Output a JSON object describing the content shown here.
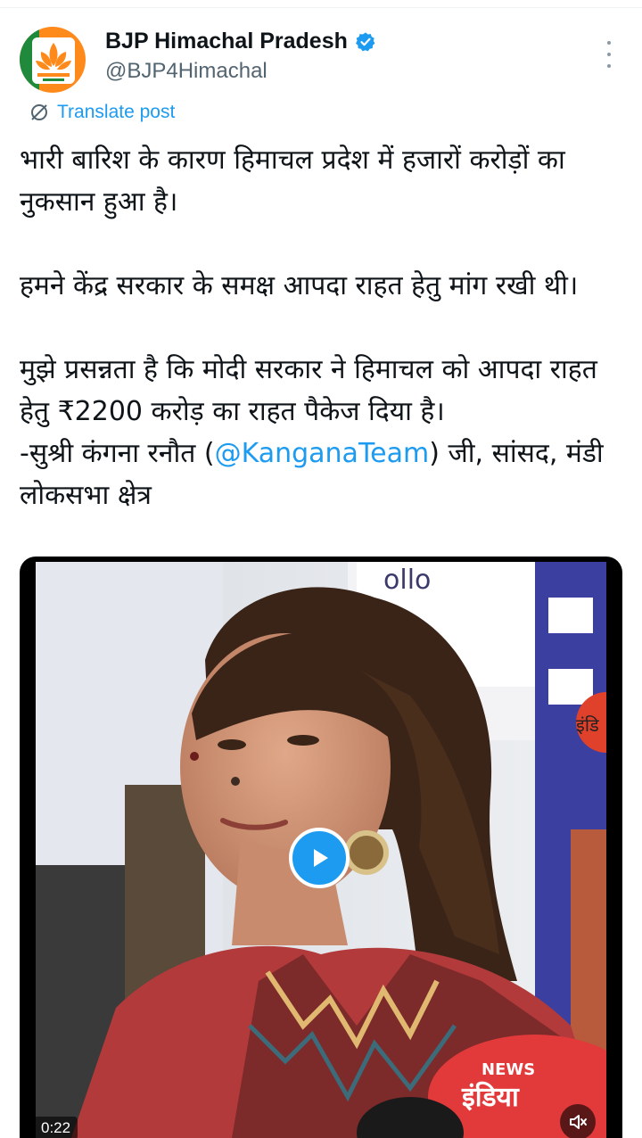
{
  "account": {
    "display_name": "BJP Himachal Pradesh",
    "handle": "@BJP4Himachal",
    "verified": true,
    "avatar_icon": "lotus-logo-icon"
  },
  "translate": {
    "label": "Translate post",
    "icon": "globe-icon"
  },
  "post": {
    "paragraph_1": "भारी बारिश के कारण हिमाचल प्रदेश में हजारों करोड़ों का नुकसान हुआ है।",
    "paragraph_2": "हमने केंद्र सरकार के समक्ष आपदा राहत हेतु मांग रखी थी।",
    "paragraph_3_line_1": "मुझे प्रसन्नता है कि मोदी सरकार ने हिमाचल को आपदा राहत हेतु ₹2200 करोड़ का राहत पैकेज दिया है।",
    "paragraph_3_prefix": "-सुश्री कंगना रनौत  (",
    "mention": "@KanganaTeam",
    "paragraph_3_suffix": ") जी, सांसद, मंडी लोकसभा क्षेत्र"
  },
  "video": {
    "timestamp": "0:22",
    "play_icon": "play-icon",
    "volume_icon": "speaker-muted-icon",
    "overlay_texts": {
      "mic_logo": "NEWS",
      "mic_brand": "इंडिया",
      "wall_text": "इंडि",
      "banner_text": "ollo"
    }
  },
  "colors": {
    "accent": "#1d9bf0",
    "text": "#0f1419",
    "secondary": "#536471",
    "avatar_bg": "#ff8a1c"
  }
}
